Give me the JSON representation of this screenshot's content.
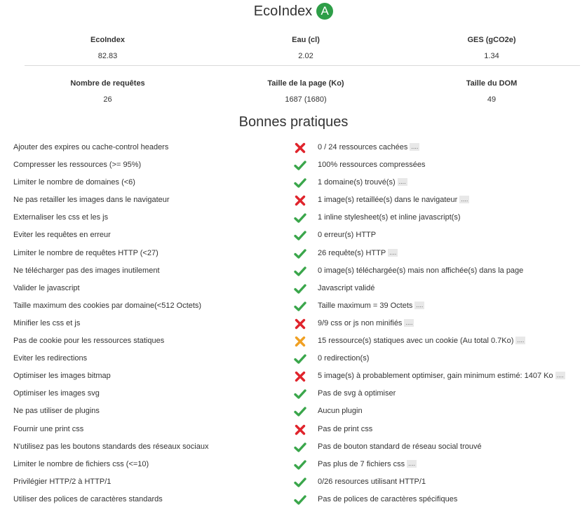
{
  "header": {
    "title": "EcoIndex",
    "grade": "A",
    "grade_color": "#2e9e48"
  },
  "metrics": [
    {
      "label": "EcoIndex",
      "value": "82.83"
    },
    {
      "label": "Eau (cl)",
      "value": "2.02"
    },
    {
      "label": "GES (gCO2e)",
      "value": "1.34"
    },
    {
      "label": "Nombre de requêtes",
      "value": "26"
    },
    {
      "label": "Taille de la page (Ko)",
      "value": "1687 (1680)"
    },
    {
      "label": "Taille du DOM",
      "value": "49"
    }
  ],
  "practices_title": "Bonnes pratiques",
  "status_colors": {
    "ok": "#3aa64b",
    "ko": "#e0242c",
    "warn": "#f0a023"
  },
  "more_label": "....",
  "practices": [
    {
      "name": "Ajouter des expires ou cache-control headers",
      "status": "ko",
      "comment": "0 / 24 ressources cachées",
      "more": true
    },
    {
      "name": "Compresser les ressources (>= 95%)",
      "status": "ok",
      "comment": "100% ressources compressées",
      "more": false
    },
    {
      "name": "Limiter le nombre de domaines (<6)",
      "status": "ok",
      "comment": "1 domaine(s) trouvé(s)",
      "more": true
    },
    {
      "name": "Ne pas retailler les images dans le navigateur",
      "status": "ko",
      "comment": "1 image(s) retaillée(s) dans le navigateur",
      "more": true
    },
    {
      "name": "Externaliser les css et les js",
      "status": "ok",
      "comment": "1 inline stylesheet(s) et inline javascript(s)",
      "more": false
    },
    {
      "name": "Eviter les requêtes en erreur",
      "status": "ok",
      "comment": "0 erreur(s) HTTP",
      "more": false
    },
    {
      "name": "Limiter le nombre de requêtes HTTP (<27)",
      "status": "ok",
      "comment": "26 requête(s) HTTP",
      "more": true
    },
    {
      "name": "Ne télécharger pas des images inutilement",
      "status": "ok",
      "comment": "0 image(s) téléchargée(s) mais non affichée(s) dans la page",
      "more": false
    },
    {
      "name": "Valider le javascript",
      "status": "ok",
      "comment": "Javascript validé",
      "more": false
    },
    {
      "name": "Taille maximum des cookies par domaine(<512 Octets)",
      "status": "ok",
      "comment": "Taille maximum = 39 Octets",
      "more": true
    },
    {
      "name": "Minifier les css et js",
      "status": "ko",
      "comment": "9/9 css or js non minifiés",
      "more": true
    },
    {
      "name": "Pas de cookie pour les ressources statiques",
      "status": "warn",
      "comment": "15 ressource(s) statiques avec un cookie (Au total 0.7Ko)",
      "more": true
    },
    {
      "name": "Eviter les redirections",
      "status": "ok",
      "comment": "0 redirection(s)",
      "more": false
    },
    {
      "name": "Optimiser les images bitmap",
      "status": "ko",
      "comment": "5 image(s) à probablement optimiser, gain minimum estimé: 1407 Ko",
      "more": true
    },
    {
      "name": "Optimiser les images svg",
      "status": "ok",
      "comment": "Pas de svg à optimiser",
      "more": false
    },
    {
      "name": "Ne pas utiliser de plugins",
      "status": "ok",
      "comment": "Aucun plugin",
      "more": false
    },
    {
      "name": "Fournir une print css",
      "status": "ko",
      "comment": "Pas de print css",
      "more": false
    },
    {
      "name": "N'utilisez pas les boutons standards des réseaux sociaux",
      "status": "ok",
      "comment": "Pas de bouton standard de réseau social trouvé",
      "more": false
    },
    {
      "name": "Limiter le nombre de fichiers css (<=10)",
      "status": "ok",
      "comment": "Pas plus de 7 fichiers css",
      "more": true
    },
    {
      "name": "Privilégier HTTP/2 à HTTP/1",
      "status": "ok",
      "comment": "0/26 resources utilisant HTTP/1",
      "more": false
    },
    {
      "name": "Utiliser des polices de caractères standards",
      "status": "ok",
      "comment": "Pas de polices de caractères spécifiques",
      "more": false
    }
  ]
}
